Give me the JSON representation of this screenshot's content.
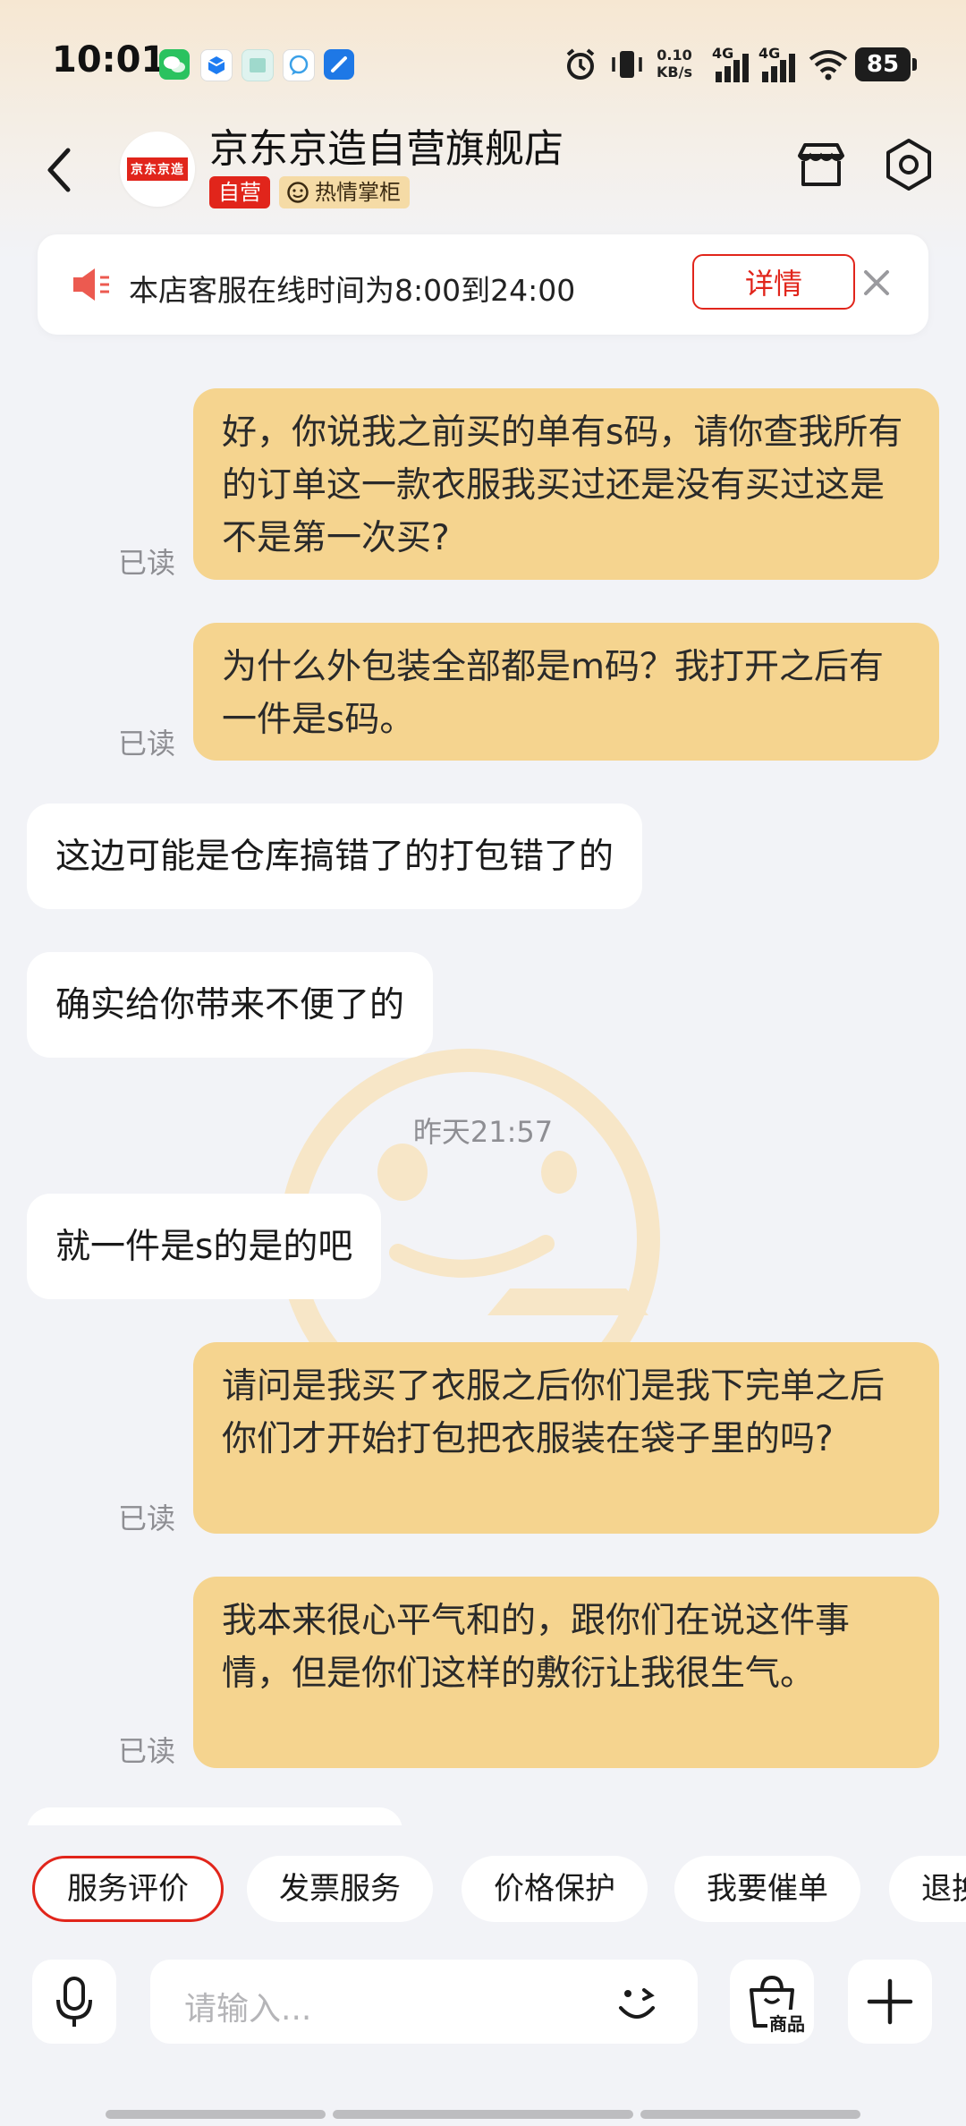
{
  "status_bar": {
    "time": "10:01",
    "net_speed_value": "0.10",
    "net_speed_unit": "KB/s",
    "signal_1": "4G",
    "signal_2": "4G",
    "battery": "85"
  },
  "header": {
    "shop_name": "京东京造自营旗舰店",
    "avatar_logo": "京东京造",
    "tag_self": "自营",
    "tag_keeper": "热情掌柜"
  },
  "notice": {
    "text": "本店客服在线时间为8:00到24:00",
    "detail_label": "详情"
  },
  "messages": [
    {
      "side": "me",
      "text": "好，你说我之前买的单有s码，请你查我所有的订单这一款衣服我买过还是没有买过这是不是第一次买?",
      "status": "已读"
    },
    {
      "side": "me",
      "text": "为什么外包装全部都是m码？我打开之后有一件是s码。",
      "status": "已读"
    },
    {
      "side": "them",
      "text": "这边可能是仓库搞错了的打包错了的"
    },
    {
      "side": "them",
      "text": "确实给你带来不便了的"
    },
    {
      "side": "them",
      "text": "就一件是s的是的吧"
    },
    {
      "side": "me",
      "text": "请问是我买了衣服之后你们是我下完单之后你们才开始打包把衣服装在袋子里的吗?",
      "status": "已读"
    },
    {
      "side": "me",
      "text": "我本来很心平气和的，跟你们在说这件事情，但是你们这样的敷衍让我很生气。",
      "status": "已读"
    }
  ],
  "timestamp": "昨天21:57",
  "quick_replies": [
    "服务评价",
    "发票服务",
    "价格保护",
    "我要催单",
    "退换"
  ],
  "input": {
    "placeholder": "请输入...",
    "product_label": "商品"
  },
  "colors": {
    "accent_red": "#e1251b",
    "my_bubble": "#f5d48f",
    "their_bubble": "#ffffff",
    "background": "#f2f3f7"
  }
}
